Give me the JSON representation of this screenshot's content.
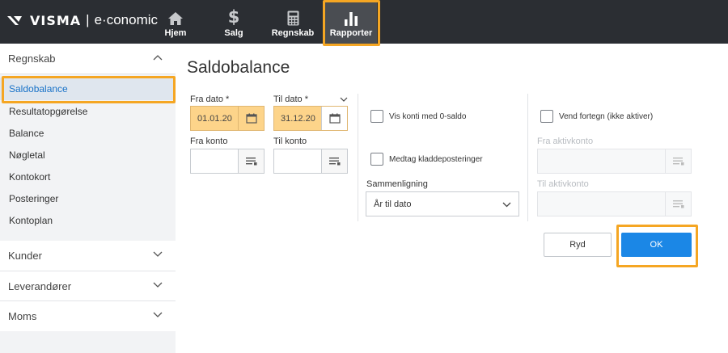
{
  "brand": {
    "name": "VISMA",
    "separator": "|",
    "app": "e·conomic"
  },
  "topnav": [
    {
      "label": "Hjem",
      "icon": "home-icon"
    },
    {
      "label": "Salg",
      "icon": "dollar-icon"
    },
    {
      "label": "Regnskab",
      "icon": "calculator-icon"
    },
    {
      "label": "Rapporter",
      "icon": "bar-chart-icon",
      "active": true
    }
  ],
  "sidebar": {
    "sections": [
      {
        "label": "Regnskab",
        "expanded": true
      },
      {
        "label": "Kunder",
        "expanded": false
      },
      {
        "label": "Leverandører",
        "expanded": false
      },
      {
        "label": "Moms",
        "expanded": false
      }
    ],
    "items": [
      {
        "label": "Saldobalance",
        "selected": true
      },
      {
        "label": "Resultatopgørelse"
      },
      {
        "label": "Balance"
      },
      {
        "label": "Nøgletal"
      },
      {
        "label": "Kontokort"
      },
      {
        "label": "Posteringer"
      },
      {
        "label": "Kontoplan"
      }
    ]
  },
  "main": {
    "title": "Saldobalance",
    "fra_dato": {
      "label": "Fra dato *",
      "value": "01.01.20"
    },
    "til_dato": {
      "label": "Til dato *",
      "value": "31.12.20"
    },
    "fra_konto": {
      "label": "Fra konto",
      "value": ""
    },
    "til_konto": {
      "label": "Til konto",
      "value": ""
    },
    "checkbox_zero": {
      "label": "Vis konti med 0-saldo",
      "checked": false
    },
    "checkbox_kladde": {
      "label": "Medtag kladdeposteringer",
      "checked": false
    },
    "checkbox_vend": {
      "label": "Vend fortegn (ikke aktiver)",
      "checked": false
    },
    "sammenligning": {
      "label": "Sammenligning",
      "value": "År til dato"
    },
    "fra_aktivkonto": {
      "label": "Fra aktivkonto",
      "value": ""
    },
    "til_aktivkonto": {
      "label": "Til aktivkonto",
      "value": ""
    },
    "buttons": {
      "ryd": "Ryd",
      "ok": "OK"
    }
  },
  "colors": {
    "topbar": "#2b2e33",
    "accent": "#1b87e6",
    "highlight": "#f5a623",
    "date_fill": "#fdd48a"
  }
}
